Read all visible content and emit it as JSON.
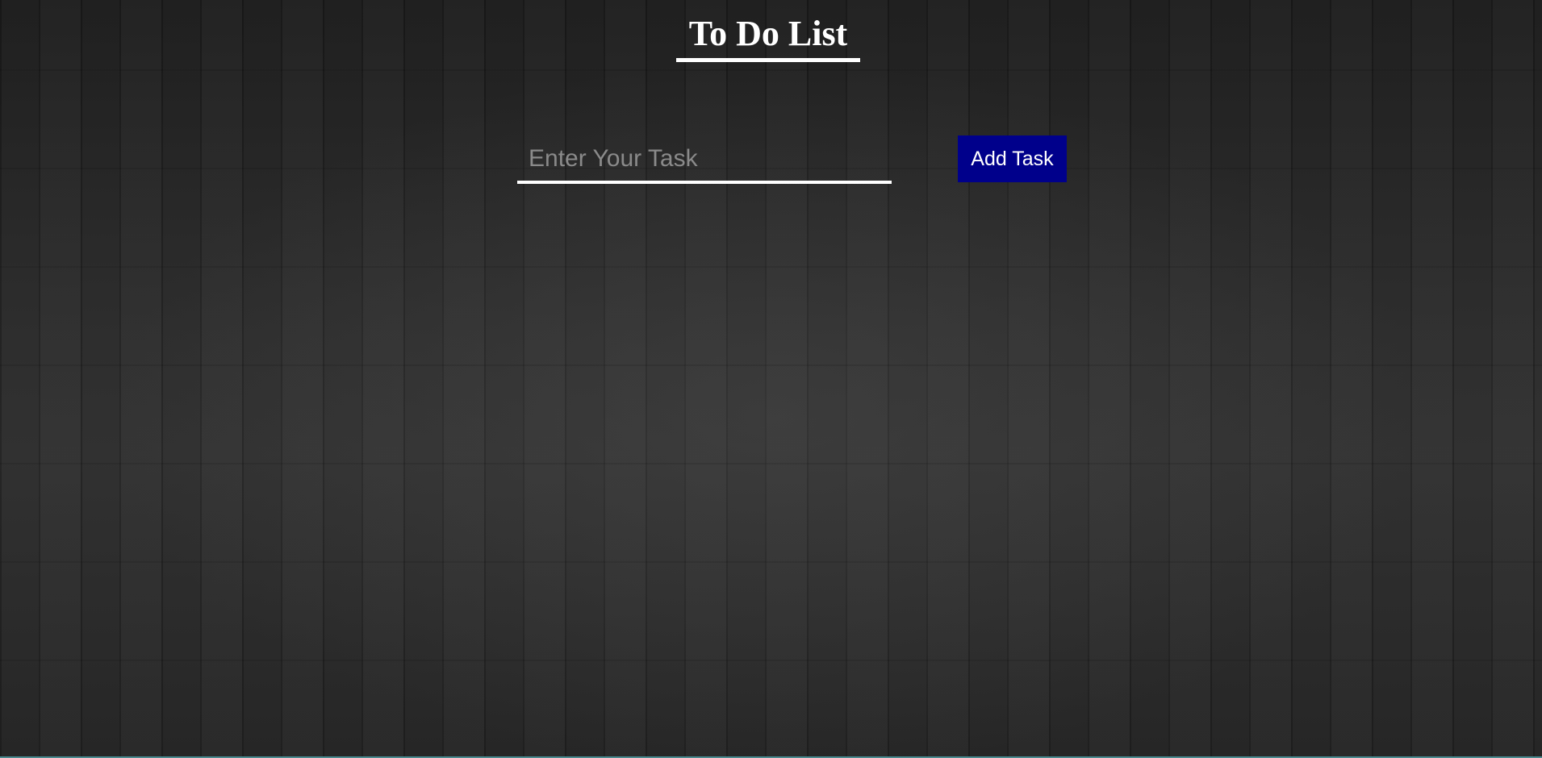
{
  "header": {
    "title": "To Do List"
  },
  "task_form": {
    "input_placeholder": "Enter Your Task",
    "input_value": "",
    "add_button_label": "Add Task"
  },
  "colors": {
    "button_background": "#00008b",
    "text": "#ffffff",
    "placeholder": "#8a8a8a",
    "background": "#2a2a2a"
  }
}
